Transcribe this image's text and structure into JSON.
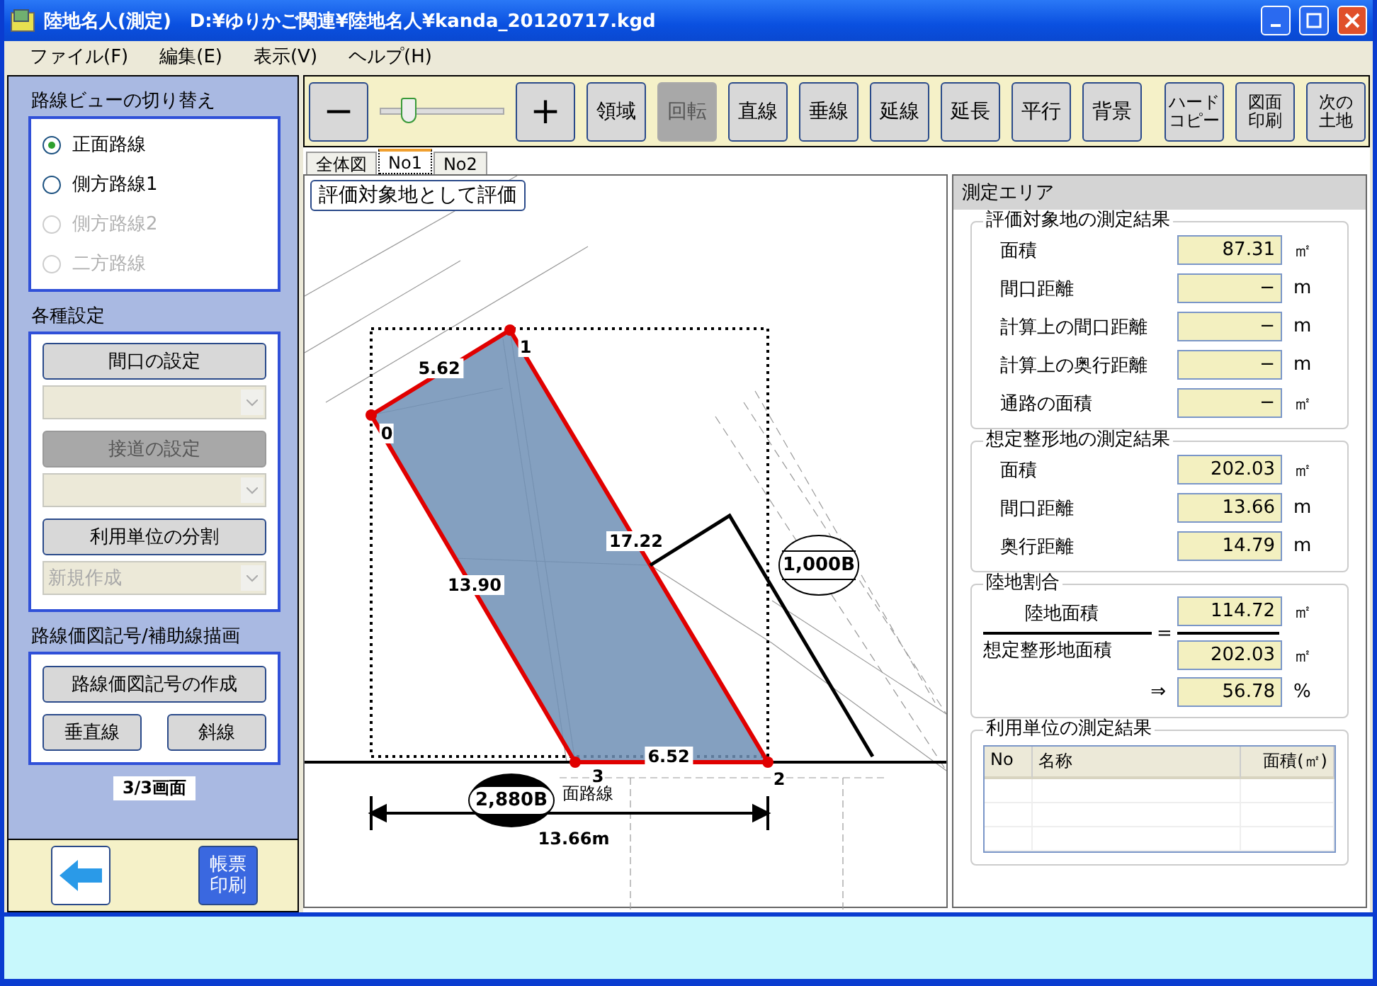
{
  "window": {
    "title": "陸地名人(測定)　D:¥ゆりかご関連¥陸地名人¥kanda_20120717.kgd"
  },
  "menu": [
    "ファイル(F)",
    "編集(E)",
    "表示(V)",
    "ヘルプ(H)"
  ],
  "sidebar": {
    "route_view": {
      "title": "路線ビューの切り替え",
      "options": [
        {
          "label": "正面路線",
          "selected": true,
          "disabled": false
        },
        {
          "label": "側方路線1",
          "selected": false,
          "disabled": false
        },
        {
          "label": "側方路線2",
          "selected": false,
          "disabled": true
        },
        {
          "label": "二方路線",
          "selected": false,
          "disabled": true
        }
      ]
    },
    "settings": {
      "title": "各種設定",
      "items": [
        {
          "kind": "button",
          "label": "間口の設定",
          "disabled": false
        },
        {
          "kind": "dropdown",
          "disabled": true
        },
        {
          "kind": "button",
          "label": "接道の設定",
          "disabled": true
        },
        {
          "kind": "dropdown",
          "disabled": true
        },
        {
          "kind": "button",
          "label": "利用単位の分割",
          "disabled": false
        },
        {
          "kind": "dropdown",
          "value": "新規作成",
          "disabled": true
        }
      ]
    },
    "symbols": {
      "title": "路線価図記号/補助線描画",
      "main_button": "路線価図記号の作成",
      "buttons": [
        "垂直線",
        "斜線"
      ]
    },
    "page_indicator": "3/3画面",
    "print_button": [
      "帳票",
      "印刷"
    ]
  },
  "toolbar": {
    "zoom_out": "−",
    "zoom": {
      "level": 0.22
    },
    "zoom_in": "+",
    "tools": [
      {
        "label": "領域",
        "active": false
      },
      {
        "label": "回転",
        "active": true
      },
      {
        "label": "直線",
        "active": false
      },
      {
        "label": "垂線",
        "active": false
      },
      {
        "label": "延線",
        "active": false
      },
      {
        "label": "延長",
        "active": false
      },
      {
        "label": "平行",
        "active": false
      },
      {
        "label": "背景",
        "active": false
      }
    ],
    "actions": [
      [
        "ハード",
        "コピー"
      ],
      [
        "図面",
        "印刷"
      ],
      [
        "次の",
        "土地"
      ]
    ]
  },
  "tabs": [
    {
      "label": "全体図",
      "selected": false
    },
    {
      "label": "No1",
      "selected": true
    },
    {
      "label": "No2",
      "selected": false
    }
  ],
  "drawing": {
    "evaluate_button": "評価対象地として評価",
    "vertices": [
      "0",
      "1",
      "2",
      "3"
    ],
    "edges": [
      "5.62",
      "13.90",
      "17.22",
      "6.52"
    ],
    "route_prices": [
      {
        "label": "2,880B",
        "kind": "front"
      },
      {
        "label": "1,000B",
        "kind": "side"
      }
    ],
    "road_label": "面路線",
    "dimension": "13.66m"
  },
  "measure": {
    "title": "測定エリア",
    "groups": [
      {
        "title": "評価対象地の測定結果",
        "rows": [
          {
            "label": "面積",
            "value": "87.31",
            "unit": "㎡"
          },
          {
            "label": "間口距離",
            "value": "−",
            "unit": "m"
          },
          {
            "label": "計算上の間口距離",
            "value": "−",
            "unit": "m"
          },
          {
            "label": "計算上の奥行距離",
            "value": "−",
            "unit": "m"
          },
          {
            "label": "通路の面積",
            "value": "−",
            "unit": "㎡"
          }
        ]
      },
      {
        "title": "想定整形地の測定結果",
        "rows": [
          {
            "label": "面積",
            "value": "202.03",
            "unit": "㎡"
          },
          {
            "label": "間口距離",
            "value": "13.66",
            "unit": "m"
          },
          {
            "label": "奥行距離",
            "value": "14.79",
            "unit": "m"
          }
        ]
      }
    ],
    "ratio": {
      "title": "陸地割合",
      "numerator": "陸地面積",
      "denominator": "想定整形地面積",
      "equals": "=",
      "arrow": "⇒",
      "numerator_value": "114.72",
      "numerator_unit": "㎡",
      "denominator_value": "202.03",
      "denominator_unit": "㎡",
      "result_value": "56.78",
      "result_unit": "%"
    },
    "units": {
      "title": "利用単位の測定結果",
      "columns": [
        "No",
        "名称",
        "面積(㎡)"
      ]
    }
  }
}
